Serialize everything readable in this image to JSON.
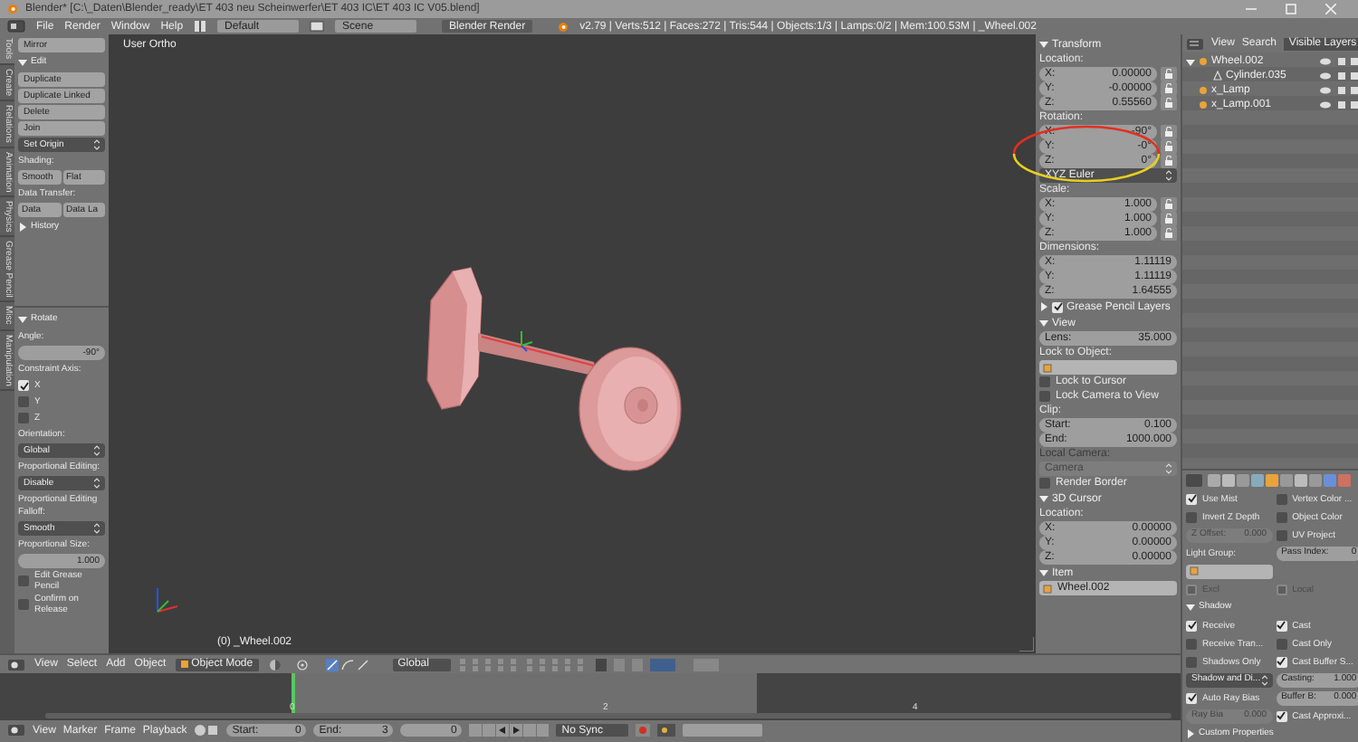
{
  "title_bar": {
    "title": "Blender* [C:\\_Daten\\Blender_ready\\ET 403 neu Scheinwerfer\\ET 403 IC\\ET 403 IC V05.blend]"
  },
  "menu_bar": {
    "menus": [
      "File",
      "Render",
      "Window",
      "Help"
    ],
    "layout": "Default",
    "scene": "Scene",
    "engine": "Blender Render",
    "stats": "v2.79 | Verts:512 | Faces:272 | Tris:544 | Objects:1/3 | Lamps:0/2 | Mem:100.53M | _Wheel.002"
  },
  "tool_shelf": {
    "tabs": [
      {
        "label": "Tools",
        "selected": true
      },
      {
        "label": "Create",
        "selected": false
      },
      {
        "label": "Relations",
        "selected": false
      },
      {
        "label": "Animation",
        "selected": false
      },
      {
        "label": "Physics",
        "selected": false
      },
      {
        "label": "Grease Pencil",
        "selected": false
      },
      {
        "label": "Misc",
        "selected": false
      },
      {
        "label": "Manipulation",
        "selected": false
      }
    ],
    "rows": [
      {
        "kind": "button",
        "label": "Mirror"
      },
      {
        "kind": "panel",
        "label": "Edit",
        "expanded": true
      },
      {
        "kind": "button",
        "label": "Duplicate"
      },
      {
        "kind": "button",
        "label": "Duplicate Linked"
      },
      {
        "kind": "button",
        "label": "Delete"
      },
      {
        "kind": "button",
        "label": "Join"
      },
      {
        "kind": "dropdown",
        "value": "Set Origin"
      },
      {
        "kind": "label",
        "text": "Shading:"
      },
      {
        "kind": "buttons",
        "labels": [
          "Smooth",
          "Flat"
        ]
      },
      {
        "kind": "label",
        "text": "Data Transfer:"
      },
      {
        "kind": "buttons",
        "labels": [
          "Data",
          "Data La"
        ]
      },
      {
        "kind": "panel",
        "label": "History",
        "expanded": false
      }
    ]
  },
  "operator_panel": {
    "rows": [
      {
        "kind": "panel",
        "label": "Rotate",
        "expanded": true
      },
      {
        "kind": "label",
        "text": "Angle:"
      },
      {
        "kind": "field",
        "label": "",
        "value": "-90°"
      },
      {
        "kind": "label",
        "text": "Constraint Axis:"
      },
      {
        "kind": "check",
        "label": "X",
        "checked": true
      },
      {
        "kind": "check",
        "label": "Y",
        "checked": false
      },
      {
        "kind": "check",
        "label": "Z",
        "checked": false
      },
      {
        "kind": "label",
        "text": "Orientation:"
      },
      {
        "kind": "dropdown",
        "value": "Global"
      },
      {
        "kind": "label",
        "text": "Proportional Editing:"
      },
      {
        "kind": "dropdown",
        "value": "Disable"
      },
      {
        "kind": "label",
        "text": "Proportional Editing Falloff:"
      },
      {
        "kind": "dropdown",
        "value": "Smooth"
      },
      {
        "kind": "label",
        "text": "Proportional Size:"
      },
      {
        "kind": "field",
        "label": "",
        "value": "1.000"
      },
      {
        "kind": "check",
        "label": "Edit Grease Pencil",
        "checked": false
      },
      {
        "kind": "check",
        "label": "Confirm on Release",
        "checked": false
      }
    ]
  },
  "viewport": {
    "view_label": "User Ortho",
    "object_label": "(0) _Wheel.002"
  },
  "view3d_header": {
    "menus": [
      "View",
      "Select",
      "Add",
      "Object"
    ],
    "mode": "Object Mode",
    "orientation": "Global"
  },
  "timeline": {
    "ticks": [
      "0",
      "2",
      "4"
    ],
    "menus": [
      "View",
      "Marker",
      "Frame",
      "Playback"
    ],
    "start": {
      "label": "Start:",
      "value": "0"
    },
    "end": {
      "label": "End:",
      "value": "3"
    },
    "current": "0",
    "sync": "No Sync"
  },
  "n_panel": {
    "rows": [
      {
        "kind": "panel",
        "label": "Transform",
        "expanded": true
      },
      {
        "kind": "label",
        "text": "Location:"
      },
      {
        "kind": "field",
        "label": "X:",
        "value": "0.00000",
        "lock": true
      },
      {
        "kind": "field",
        "label": "Y:",
        "value": "-0.00000",
        "lock": true
      },
      {
        "kind": "field",
        "label": "Z:",
        "value": "0.55560",
        "lock": true
      },
      {
        "kind": "label",
        "text": "Rotation:"
      },
      {
        "kind": "field",
        "label": "X:",
        "value": "-90°",
        "lock": true
      },
      {
        "kind": "field",
        "label": "Y:",
        "value": "-0°",
        "lock": true
      },
      {
        "kind": "field",
        "label": "Z:",
        "value": "0°",
        "lock": true
      },
      {
        "kind": "dropdown",
        "value": "XYZ Euler"
      },
      {
        "kind": "label",
        "text": "Scale:"
      },
      {
        "kind": "field",
        "label": "X:",
        "value": "1.000",
        "lock": true
      },
      {
        "kind": "field",
        "label": "Y:",
        "value": "1.000",
        "lock": true
      },
      {
        "kind": "field",
        "label": "Z:",
        "value": "1.000",
        "lock": true
      },
      {
        "kind": "label",
        "text": "Dimensions:"
      },
      {
        "kind": "field",
        "label": "X:",
        "value": "1.11119"
      },
      {
        "kind": "field",
        "label": "Y:",
        "value": "1.11119"
      },
      {
        "kind": "field",
        "label": "Z:",
        "value": "1.64555"
      },
      {
        "kind": "panel",
        "label": "Grease Pencil Layers",
        "expanded": false,
        "checked": true
      },
      {
        "kind": "panel",
        "label": "View",
        "expanded": true
      },
      {
        "kind": "field",
        "label": "Lens:",
        "value": "35.000"
      },
      {
        "kind": "label",
        "text": "Lock to Object:"
      },
      {
        "kind": "text_field",
        "value": ""
      },
      {
        "kind": "check",
        "label": "Lock to Cursor",
        "checked": false
      },
      {
        "kind": "check",
        "label": "Lock Camera to View",
        "checked": false
      },
      {
        "kind": "label",
        "text": "Clip:"
      },
      {
        "kind": "field",
        "label": "Start:",
        "value": "0.100"
      },
      {
        "kind": "field",
        "label": "End:",
        "value": "1000.000"
      },
      {
        "kind": "label",
        "text": "Local Camera:",
        "disabled": true
      },
      {
        "kind": "dropdown",
        "value": "Camera",
        "disabled": true
      },
      {
        "kind": "check",
        "label": "Render Border",
        "checked": false
      },
      {
        "kind": "panel",
        "label": "3D Cursor",
        "expanded": true
      },
      {
        "kind": "label",
        "text": "Location:"
      },
      {
        "kind": "field",
        "label": "X:",
        "value": "0.00000"
      },
      {
        "kind": "field",
        "label": "Y:",
        "value": "0.00000"
      },
      {
        "kind": "field",
        "label": "Z:",
        "value": "0.00000"
      },
      {
        "kind": "panel",
        "label": "Item",
        "expanded": true
      },
      {
        "kind": "text_field",
        "value": "Wheel.002"
      }
    ]
  },
  "outliner": {
    "menus": [
      "View",
      "Search"
    ],
    "filter": "Visible Layers",
    "items": [
      {
        "name": "Wheel.002",
        "expanded": true,
        "children": [
          {
            "name": "Cylinder.035"
          }
        ]
      },
      {
        "name": "x_Lamp"
      },
      {
        "name": "x_Lamp.001"
      }
    ]
  },
  "properties": {
    "rows": [
      {
        "kind": "pair",
        "items": [
          {
            "kind": "check",
            "label": "Use Mist",
            "checked": true
          },
          {
            "kind": "check",
            "label": "Vertex Color ...",
            "checked": false
          }
        ]
      },
      {
        "kind": "pair",
        "items": [
          {
            "kind": "check",
            "label": "Invert Z Depth",
            "checked": false
          },
          {
            "kind": "check",
            "label": "Object Color",
            "checked": false
          }
        ]
      },
      {
        "kind": "pair",
        "items": [
          {
            "kind": "field",
            "label": "Z Offset:",
            "value": "0.000",
            "disabled": true
          },
          {
            "kind": "check",
            "label": "UV Project",
            "checked": false
          }
        ]
      },
      {
        "kind": "pair",
        "items": [
          {
            "kind": "label",
            "text": "Light Group:"
          },
          {
            "kind": "field",
            "label": "Pass Index:",
            "value": "0"
          }
        ]
      },
      {
        "kind": "pair",
        "items": [
          {
            "kind": "text_field",
            "value": ""
          }
        ]
      },
      {
        "kind": "pair",
        "items": [
          {
            "kind": "check",
            "label": "Excl",
            "checked": false,
            "disabled": true
          },
          {
            "kind": "check",
            "label": "Local",
            "checked": false,
            "disabled": true
          }
        ]
      },
      {
        "kind": "panel",
        "label": "Shadow",
        "expanded": true
      },
      {
        "kind": "pair",
        "items": [
          {
            "kind": "check",
            "label": "Receive",
            "checked": true
          },
          {
            "kind": "check",
            "label": "Cast",
            "checked": true
          }
        ]
      },
      {
        "kind": "pair",
        "items": [
          {
            "kind": "check",
            "label": "Receive Tran...",
            "checked": false
          },
          {
            "kind": "check",
            "label": "Cast Only",
            "checked": false
          }
        ]
      },
      {
        "kind": "pair",
        "items": [
          {
            "kind": "check",
            "label": "Shadows Only",
            "checked": false
          },
          {
            "kind": "check",
            "label": "Cast Buffer S...",
            "checked": true
          }
        ]
      },
      {
        "kind": "pair",
        "items": [
          {
            "kind": "dropdown",
            "value": "Shadow and Di..."
          },
          {
            "kind": "field",
            "label": "Casting:",
            "value": "1.000"
          }
        ]
      },
      {
        "kind": "pair",
        "items": [
          {
            "kind": "check",
            "label": "Auto Ray Bias",
            "checked": true
          },
          {
            "kind": "field",
            "label": "Buffer B:",
            "value": "0.000"
          }
        ]
      },
      {
        "kind": "pair",
        "items": [
          {
            "kind": "field",
            "label": "Ray Bia",
            "value": "0.000",
            "disabled": true
          },
          {
            "kind": "check",
            "label": "Cast Approxi...",
            "checked": true
          }
        ]
      },
      {
        "kind": "panel",
        "label": "Custom Properties",
        "expanded": false
      }
    ]
  }
}
